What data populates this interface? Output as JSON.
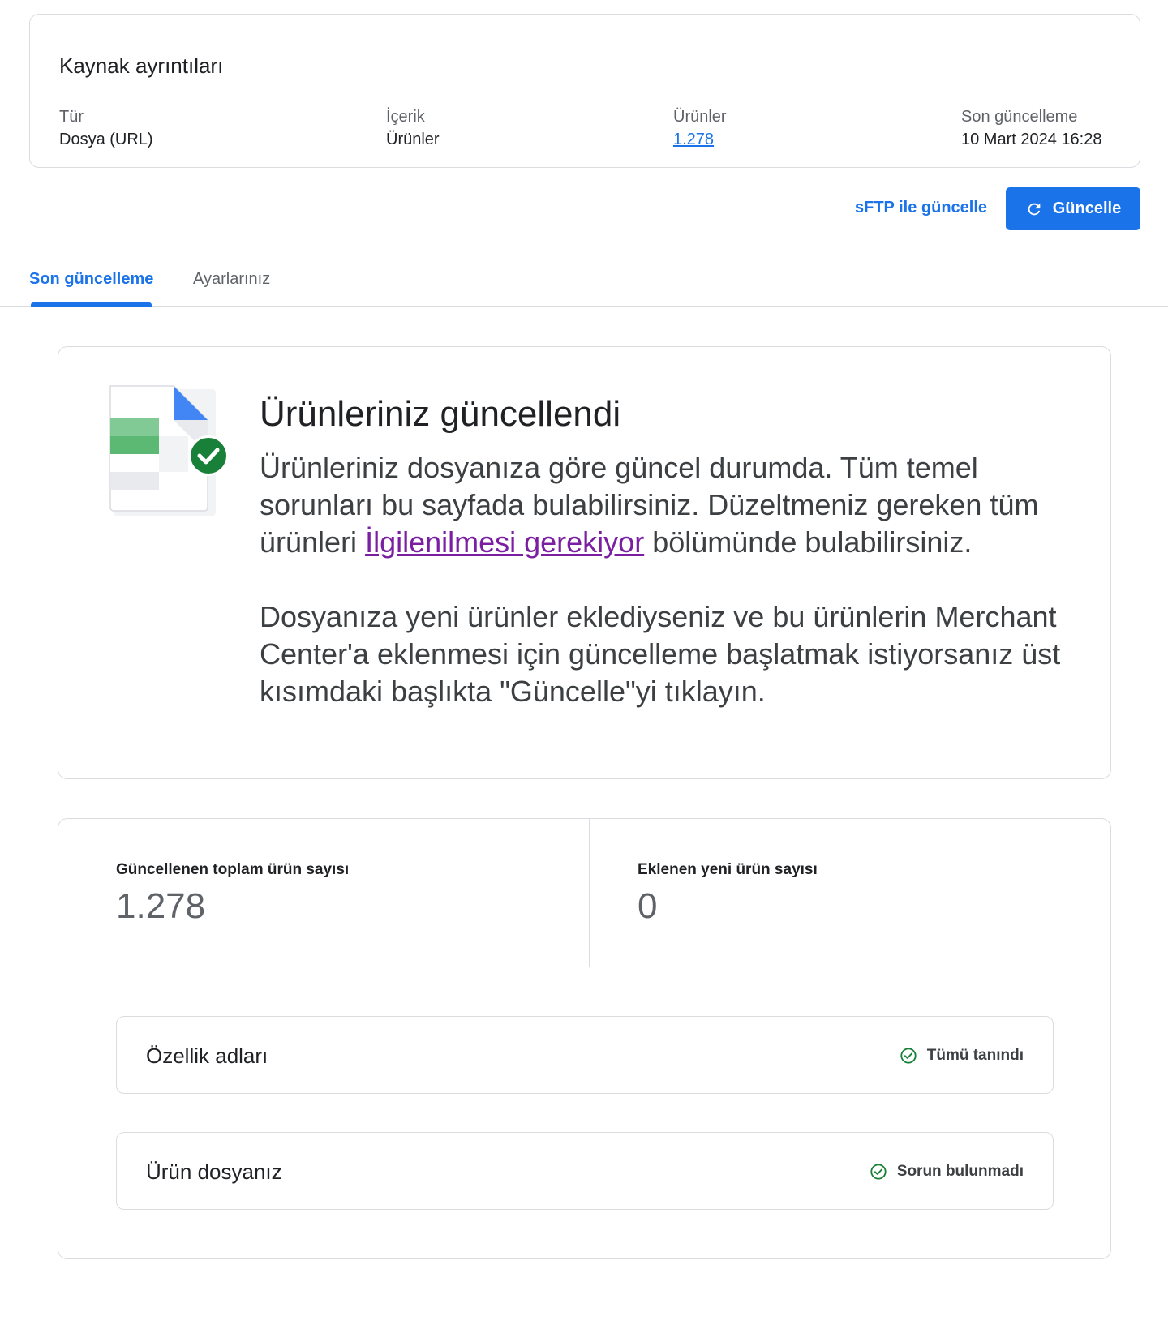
{
  "source_details": {
    "title": "Kaynak ayrıntıları",
    "columns": [
      {
        "label": "Tür",
        "value": "Dosya (URL)"
      },
      {
        "label": "İçerik",
        "value": "Ürünler"
      },
      {
        "label": "Ürünler",
        "value": "1.278"
      },
      {
        "label": "Son güncelleme",
        "value": "10 Mart 2024 16:28"
      }
    ]
  },
  "actions": {
    "sftp_label": "sFTP ile güncelle",
    "update_label": "Güncelle"
  },
  "tabs": [
    {
      "label": "Son güncelleme",
      "active": true
    },
    {
      "label": "Ayarlarınız",
      "active": false
    }
  ],
  "status": {
    "heading": "Ürünleriniz güncellendi",
    "para1_before": "Ürünleriniz dosyanıza göre güncel durumda. Tüm temel sorunları bu sayfada bulabilirsiniz. Düzeltmeniz gereken tüm ürünleri ",
    "para1_link": "İlgilenilmesi gerekiyor",
    "para1_after": " bölümünde bulabilirsiniz.",
    "para2": "Dosyanıza yeni ürünler eklediyseniz ve bu ürünlerin Merchant Center'a eklenmesi için güncelleme başlatmak istiyorsanız üst kısımdaki başlıkta \"Güncelle\"yi tıklayın."
  },
  "stats": {
    "total_label": "Güncellenen toplam ürün sayısı",
    "total_value": "1.278",
    "new_label": "Eklenen yeni ürün sayısı",
    "new_value": "0"
  },
  "checks": [
    {
      "title": "Özellik adları",
      "status": "Tümü tanındı",
      "icon": "check-circle-icon"
    },
    {
      "title": "Ürün dosyanız",
      "status": "Sorun bulunmadı",
      "icon": "check-circle-icon"
    }
  ],
  "colors": {
    "primary": "#1a73e8",
    "success": "#188038",
    "link_visited": "#7b1fa2",
    "border": "#dadce0"
  }
}
